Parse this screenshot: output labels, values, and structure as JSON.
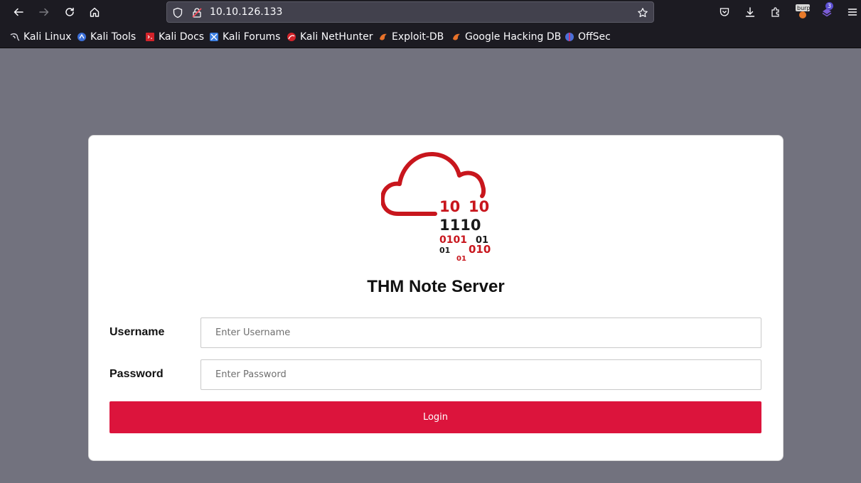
{
  "browser": {
    "url": "10.10.126.133",
    "extension_badge": "3",
    "bookmarks": [
      {
        "label": "Kali Linux",
        "icon": "kali-dragon-icon"
      },
      {
        "label": "Kali Tools",
        "icon": "kali-tools-icon"
      },
      {
        "label": "Kali Docs",
        "icon": "kali-docs-icon"
      },
      {
        "label": "Kali Forums",
        "icon": "kali-forums-icon"
      },
      {
        "label": "Kali NetHunter",
        "icon": "kali-nethunter-icon"
      },
      {
        "label": "Exploit-DB",
        "icon": "exploit-db-icon"
      },
      {
        "label": "Google Hacking DB",
        "icon": "ghdb-icon"
      },
      {
        "label": "OffSec",
        "icon": "offsec-icon"
      }
    ]
  },
  "login": {
    "title": "THM Note Server",
    "username_label": "Username",
    "username_placeholder": "Enter Username",
    "password_label": "Password",
    "password_placeholder": "Enter Password",
    "button_label": "Login"
  },
  "logo": {
    "binary_lines": [
      "10",
      "10",
      "1110",
      "0101",
      "01",
      "01",
      "010",
      "01"
    ]
  },
  "colors": {
    "accent": "#dc143c",
    "logo_red": "#c8161d",
    "page_bg": "#72727e",
    "chrome_bg": "#1c1b22"
  }
}
